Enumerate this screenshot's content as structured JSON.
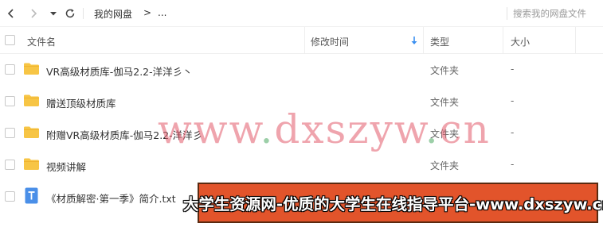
{
  "nav": {
    "breadcrumb": [
      "我的网盘",
      "..."
    ],
    "breadcrumb_separator": ">",
    "search_placeholder": "搜索我的网盘文件"
  },
  "table": {
    "columns": [
      "文件名",
      "修改时间",
      "类型",
      "大小"
    ],
    "rows": [
      {
        "name": "VR高级材质库-伽马2.2-洋洋彡丶",
        "modified": "",
        "type": "文件夹",
        "size": "-",
        "icon": "folder-icon"
      },
      {
        "name": "赠送顶级材质库",
        "modified": "",
        "type": "文件夹",
        "size": "-",
        "icon": "folder-icon"
      },
      {
        "name": "附赠VR高级材质库-伽马2.2-洋洋彡",
        "modified": "",
        "type": "文件夹",
        "size": "-",
        "icon": "folder-icon"
      },
      {
        "name": "视频讲解",
        "modified": "",
        "type": "文件夹",
        "size": "-",
        "icon": "folder-icon"
      },
      {
        "name": "《材质解密·第一季》简介.txt",
        "modified": "",
        "type": "",
        "size": "",
        "icon": "txt-file-icon"
      }
    ]
  },
  "watermark": {
    "parts": [
      "www",
      ".",
      "dxszyw",
      ".",
      "cn"
    ]
  },
  "banner": {
    "text": "大学生资源网-优质的大学生在线指导平台-www.dxszyw.cn"
  },
  "colors": {
    "folder": "#f7c545",
    "txt_icon": "#4a8fe8",
    "sort_arrow": "#3b8ff0",
    "watermark": "#e15a69",
    "banner_bg": "#e2542b",
    "banner_border": "#5a2a10"
  }
}
